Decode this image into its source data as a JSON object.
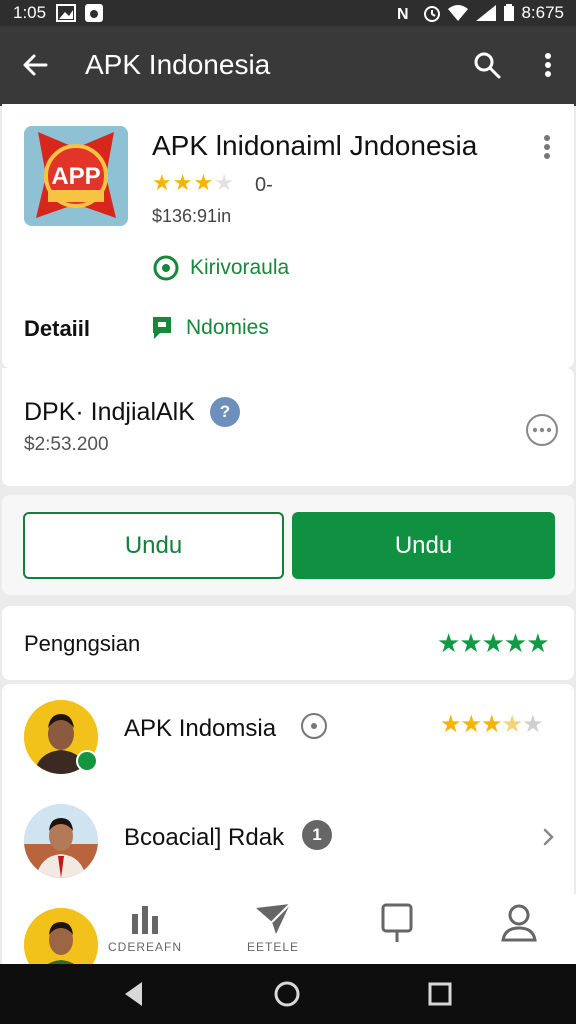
{
  "status_bar": {
    "time": "1:05",
    "clock": "8:675"
  },
  "app_bar": {
    "title": "APK Indonesia",
    "icons": [
      "back-arrow-icon",
      "search-icon",
      "more-vert-icon"
    ]
  },
  "app_header": {
    "name": "APK lnidonaiml Jndonesia",
    "icon_text": "APP",
    "rating_stars": 3,
    "rating_count": "0-",
    "price": "$136:91in",
    "tag1": "Kirivoraula",
    "detail_label": "Detaiil",
    "tag2": "Ndomies"
  },
  "developer": {
    "name": "DPK· IndjialAlK",
    "badge": "?",
    "price": "$2:53.200"
  },
  "buttons": {
    "outline_label": "Undu",
    "fill_label": "Undu"
  },
  "section": {
    "title": "Pengngsian",
    "stars": "★★★★★"
  },
  "list": {
    "items": [
      {
        "title": "APK Indomsia",
        "rating": 3.5
      },
      {
        "title": "Bcoacial] Rdak",
        "badge": "1"
      }
    ]
  },
  "bottom_nav": {
    "items": [
      {
        "label": "CDEREAFN",
        "icon": "chart-icon"
      },
      {
        "label": "EETELE",
        "icon": "send-icon"
      },
      {
        "label": "",
        "icon": "message-icon"
      },
      {
        "label": "",
        "icon": "account-icon"
      }
    ]
  },
  "colors": {
    "accent": "#109041",
    "star": "#f4b400",
    "app_bar": "#393939"
  }
}
